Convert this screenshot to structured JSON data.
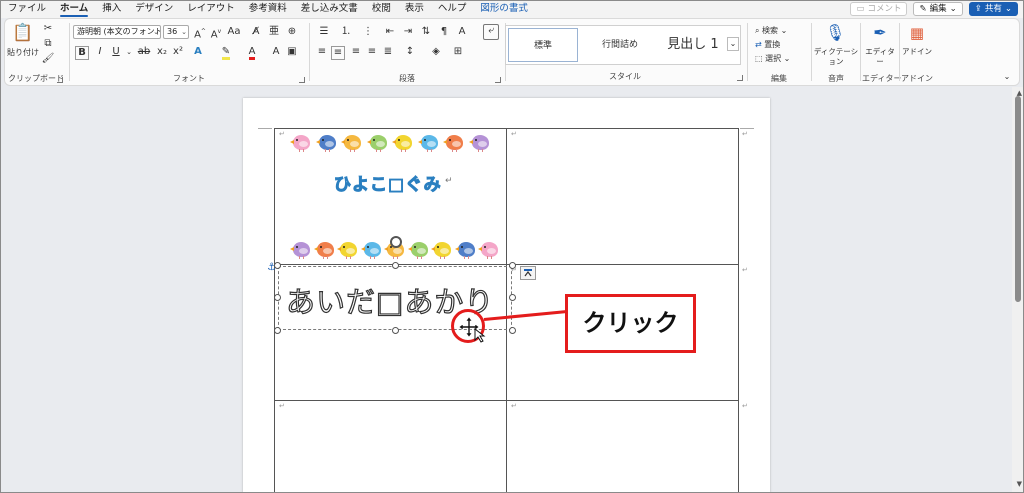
{
  "tabs": [
    "ファイル",
    "ホーム",
    "挿入",
    "デザイン",
    "レイアウト",
    "参考資料",
    "差し込み文書",
    "校閲",
    "表示",
    "ヘルプ",
    "図形の書式"
  ],
  "active_tab": "ホーム",
  "context_tab": "図形の書式",
  "titlebar": {
    "comment_label": "コメント",
    "edit_label": "編集",
    "share_label": "共有"
  },
  "ribbon": {
    "clipboard": {
      "paste_label": "貼り付け",
      "group_label": "クリップボード"
    },
    "font": {
      "font_name": "游明朝 (本文のフォント",
      "font_size": "36",
      "group_label": "フォント"
    },
    "paragraph": {
      "group_label": "段落"
    },
    "styles": {
      "items": [
        "標準",
        "行間詰め",
        "見出し 1"
      ],
      "group_label": "スタイル"
    },
    "editing": {
      "find_label": "検索",
      "replace_label": "置換",
      "select_label": "選択",
      "group_label": "編集"
    },
    "voice": {
      "dictate_label": "ディクテーション",
      "group_label": "音声"
    },
    "editor": {
      "editor_label": "エディター",
      "group_label": "エディター"
    },
    "addins": {
      "addins_label": "アドイン",
      "group_label": "アドイン"
    }
  },
  "document": {
    "title": "ひよこ□ぐみ",
    "name": "あいだ□あかり",
    "callout": "クリック"
  },
  "colors": {
    "accent": "#1a5fb4",
    "callout": "#e41c1c",
    "title_outline": "#2a7fc0"
  },
  "bird_colors_top": [
    "#f4a6c8",
    "#4f7ec8",
    "#f5b840",
    "#9bcf6b",
    "#f2d530",
    "#5bb8e8",
    "#f07e4a",
    "#b592d6"
  ],
  "bird_colors_bottom": [
    "#b592d6",
    "#f07e4a",
    "#f2d530",
    "#5bb8e8",
    "#f5b840",
    "#9bcf6b",
    "#f2d530",
    "#4f7ec8",
    "#f4a6c8"
  ]
}
